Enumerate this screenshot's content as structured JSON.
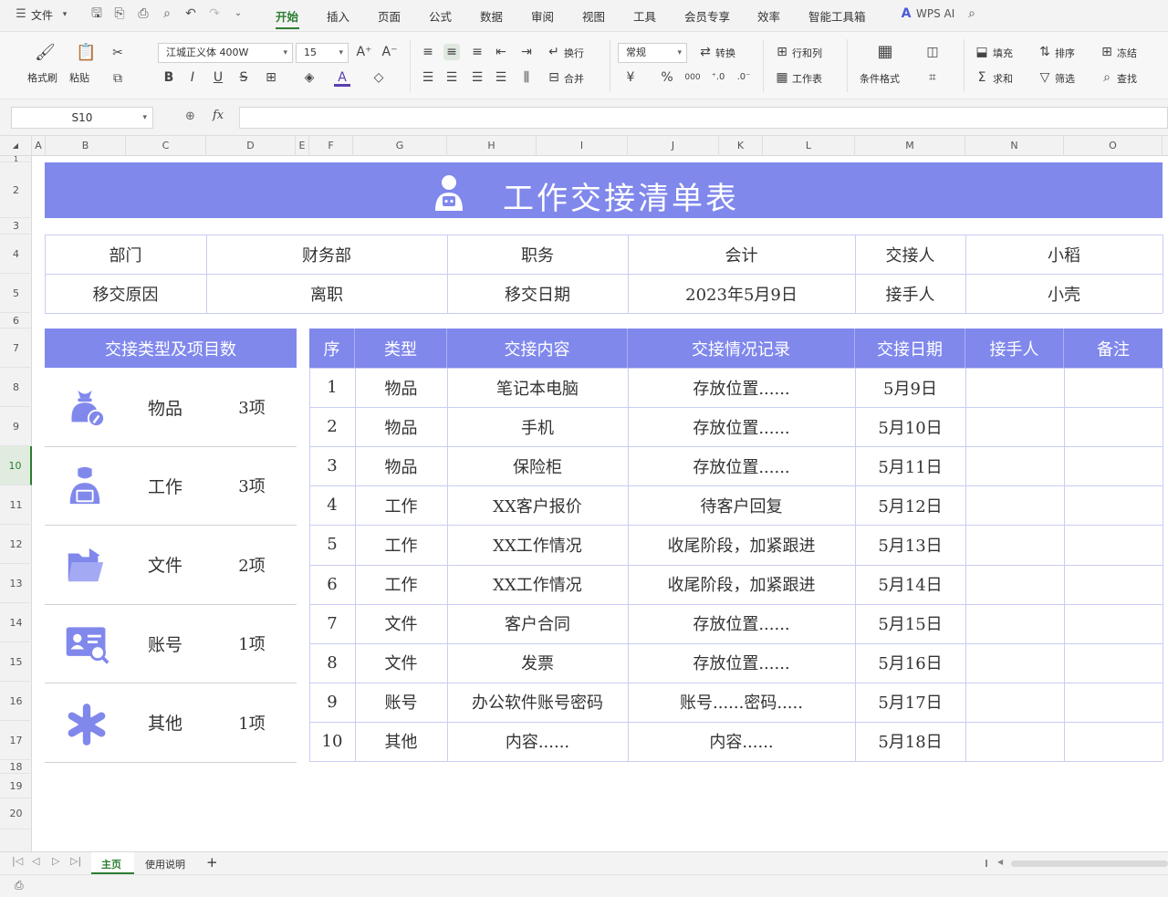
{
  "titlebar": {
    "file_menu": "文件",
    "menus": [
      "开始",
      "插入",
      "页面",
      "公式",
      "数据",
      "审阅",
      "视图",
      "工具",
      "会员专享",
      "效率",
      "智能工具箱"
    ],
    "wps_ai": "WPS AI"
  },
  "ribbon": {
    "format_brush": "格式刷",
    "paste": "粘贴",
    "font_name": "江城正义体 400W",
    "font_size": "15",
    "wrap": "换行",
    "merge": "合并",
    "number_format": "常规",
    "convert": "转换",
    "row_col": "行和列",
    "worksheet": "工作表",
    "cond_format": "条件格式",
    "fill": "填充",
    "sort": "排序",
    "freeze": "冻结",
    "sum": "求和",
    "filter": "筛选",
    "find": "查找",
    "bold": "B",
    "italic": "I",
    "underline": "U",
    "strike": "S",
    "currency": "¥",
    "percent": "%",
    "thousands": "000"
  },
  "formula": {
    "cell_ref": "S10",
    "fx": "fx",
    "content": ""
  },
  "columns": [
    "A",
    "B",
    "C",
    "D",
    "E",
    "F",
    "G",
    "H",
    "I",
    "J",
    "K",
    "L",
    "M",
    "N",
    "O"
  ],
  "rows": [
    "1",
    "2",
    "3",
    "4",
    "5",
    "6",
    "7",
    "8",
    "9",
    "10",
    "11",
    "12",
    "13",
    "14",
    "15",
    "16",
    "17",
    "18",
    "19",
    "20"
  ],
  "sheet_title": "工作交接清单表",
  "info": {
    "row1": [
      "部门",
      "财务部",
      "职务",
      "会计",
      "交接人",
      "小稻"
    ],
    "row2": [
      "移交原因",
      "离职",
      "移交日期",
      "2023年5月9日",
      "接手人",
      "小壳"
    ]
  },
  "summary": {
    "header": "交接类型及项目数",
    "items": [
      {
        "type": "物品",
        "count": "3项",
        "icon": "bag-icon"
      },
      {
        "type": "工作",
        "count": "3项",
        "icon": "worker-icon"
      },
      {
        "type": "文件",
        "count": "2项",
        "icon": "folder-icon"
      },
      {
        "type": "账号",
        "count": "1项",
        "icon": "account-card-icon"
      },
      {
        "type": "其他",
        "count": "1项",
        "icon": "asterisk-icon"
      }
    ]
  },
  "table": {
    "headers": [
      "序",
      "类型",
      "交接内容",
      "交接情况记录",
      "交接日期",
      "接手人",
      "备注"
    ],
    "rows": [
      [
        "1",
        "物品",
        "笔记本电脑",
        "存放位置......",
        "5月9日",
        "",
        ""
      ],
      [
        "2",
        "物品",
        "手机",
        "存放位置......",
        "5月10日",
        "",
        ""
      ],
      [
        "3",
        "物品",
        "保险柜",
        "存放位置......",
        "5月11日",
        "",
        ""
      ],
      [
        "4",
        "工作",
        "XX客户报价",
        "待客户回复",
        "5月12日",
        "",
        ""
      ],
      [
        "5",
        "工作",
        "XX工作情况",
        "收尾阶段，加紧跟进",
        "5月13日",
        "",
        ""
      ],
      [
        "6",
        "工作",
        "XX工作情况",
        "收尾阶段，加紧跟进",
        "5月14日",
        "",
        ""
      ],
      [
        "7",
        "文件",
        "客户合同",
        "存放位置......",
        "5月15日",
        "",
        ""
      ],
      [
        "8",
        "文件",
        "发票",
        "存放位置......",
        "5月16日",
        "",
        ""
      ],
      [
        "9",
        "账号",
        "办公软件账号密码",
        "账号......密码.....",
        "5月17日",
        "",
        ""
      ],
      [
        "10",
        "其他",
        "内容......",
        "内容......",
        "5月18日",
        "",
        ""
      ]
    ]
  },
  "sheet_tabs": [
    "主页",
    "使用说明"
  ],
  "add_sheet": "+",
  "colors": {
    "accent": "#8088ec",
    "grid": "#c9cdf2",
    "active_green": "#2e7d32"
  }
}
